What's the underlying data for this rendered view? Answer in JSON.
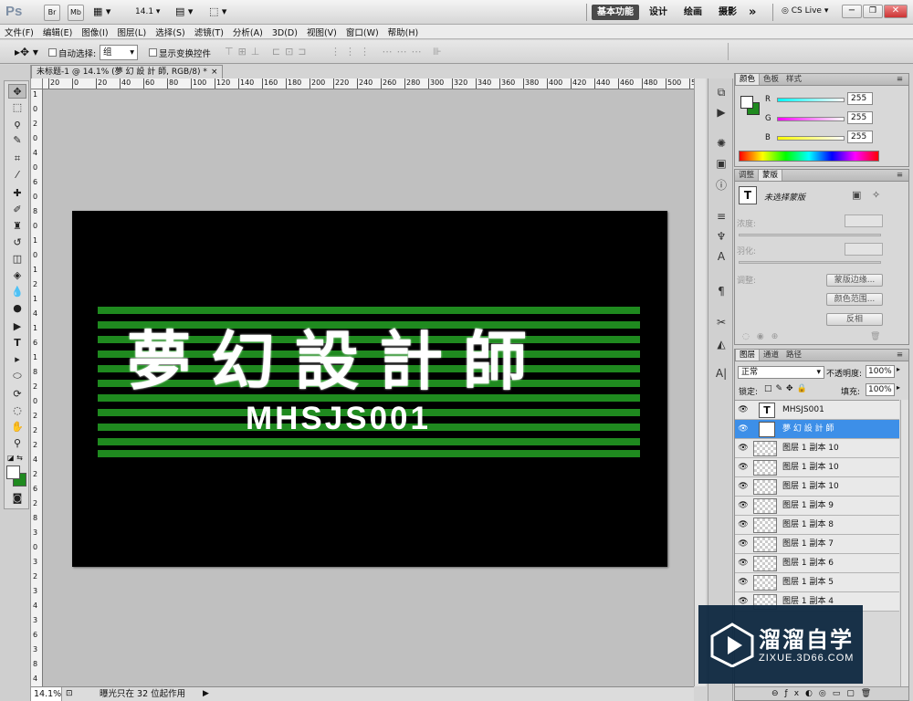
{
  "app": {
    "logo": "Ps",
    "zoom_select": "14.1",
    "workspace": {
      "active": "基本功能",
      "others": [
        "设计",
        "绘画",
        "摄影"
      ],
      "more": "»",
      "cslive": "CS Live"
    }
  },
  "menu": [
    "文件(F)",
    "编辑(E)",
    "图像(I)",
    "图层(L)",
    "选择(S)",
    "滤镜(T)",
    "分析(A)",
    "3D(D)",
    "视图(V)",
    "窗口(W)",
    "帮助(H)"
  ],
  "options": {
    "auto_select_label": "自动选择:",
    "auto_select_value": "组",
    "show_transform_label": "显示变换控件"
  },
  "document": {
    "tab_title": "未标题-1 @ 14.1% (夢 幻 設 計 師, RGB/8) *",
    "close": "×",
    "title_text": "夢幻設計師",
    "code_text": "MHSJS001",
    "stripe_color": "#1f8a1f",
    "canvas_color": "#000000"
  },
  "ruler": {
    "h_ticks": [
      "20",
      "0",
      "20",
      "40",
      "60",
      "80",
      "100",
      "120",
      "140",
      "160",
      "180",
      "200",
      "220",
      "240",
      "260",
      "280",
      "300",
      "320",
      "340",
      "360",
      "380",
      "400",
      "420",
      "440",
      "460",
      "480",
      "500",
      "52"
    ],
    "v_ticks": [
      "1",
      "0",
      "2",
      "0",
      "4",
      "0",
      "6",
      "0",
      "8",
      "0",
      "1",
      "0",
      "1",
      "2",
      "1",
      "4",
      "1",
      "6",
      "1",
      "8",
      "2",
      "0",
      "2",
      "2",
      "2",
      "4",
      "2",
      "6",
      "2",
      "8",
      "3",
      "0",
      "3",
      "2",
      "3",
      "4",
      "3",
      "6",
      "3",
      "8",
      "4",
      "0"
    ]
  },
  "status": {
    "zoom": "14.1%",
    "info": "曝光只在 32 位起作用"
  },
  "color_panel": {
    "tabs": [
      "颜色",
      "色板",
      "样式"
    ],
    "channels": [
      {
        "label": "R",
        "value": "255",
        "grad": "linear-gradient(90deg,#00ffff,#ffffff)"
      },
      {
        "label": "G",
        "value": "255",
        "grad": "linear-gradient(90deg,#ff00ff,#ffffff)"
      },
      {
        "label": "B",
        "value": "255",
        "grad": "linear-gradient(90deg,#ffff00,#ffffff)"
      }
    ],
    "foreground": "#ffffff",
    "background": "#1f8a1f"
  },
  "masks_panel": {
    "tabs": [
      "调整",
      "蒙版"
    ],
    "status": "未选择蒙版",
    "density": "浓度:",
    "feather": "羽化:",
    "refine": "调整:",
    "btn_edge": "蒙版边缘...",
    "btn_range": "颜色范围...",
    "btn_invert": "反相"
  },
  "layers_panel": {
    "tabs": [
      "图层",
      "通道",
      "路径"
    ],
    "blend": "正常",
    "opacity_label": "不透明度:",
    "opacity": "100%",
    "lock_label": "锁定:",
    "fill_label": "填充:",
    "fill": "100%",
    "layers": [
      {
        "name": "MHSJS001",
        "type": "text",
        "selected": false
      },
      {
        "name": "夢 幻 設 計 師",
        "type": "text",
        "selected": true
      },
      {
        "name": "图层 1 副本 10",
        "type": "raster",
        "selected": false
      },
      {
        "name": "图层 1 副本 10",
        "type": "raster",
        "selected": false
      },
      {
        "name": "图层 1 副本 10",
        "type": "raster",
        "selected": false
      },
      {
        "name": "图层 1 副本 9",
        "type": "raster",
        "selected": false
      },
      {
        "name": "图层 1 副本 8",
        "type": "raster",
        "selected": false
      },
      {
        "name": "图层 1 副本 7",
        "type": "raster",
        "selected": false
      },
      {
        "name": "图层 1 副本 6",
        "type": "raster",
        "selected": false
      },
      {
        "name": "图层 1 副本 5",
        "type": "raster",
        "selected": false
      },
      {
        "name": "图层 1 副本 4",
        "type": "raster",
        "selected": false
      }
    ]
  },
  "watermark": {
    "brand": "溜溜自学",
    "url": "ZIXUE.3D66.COM"
  }
}
